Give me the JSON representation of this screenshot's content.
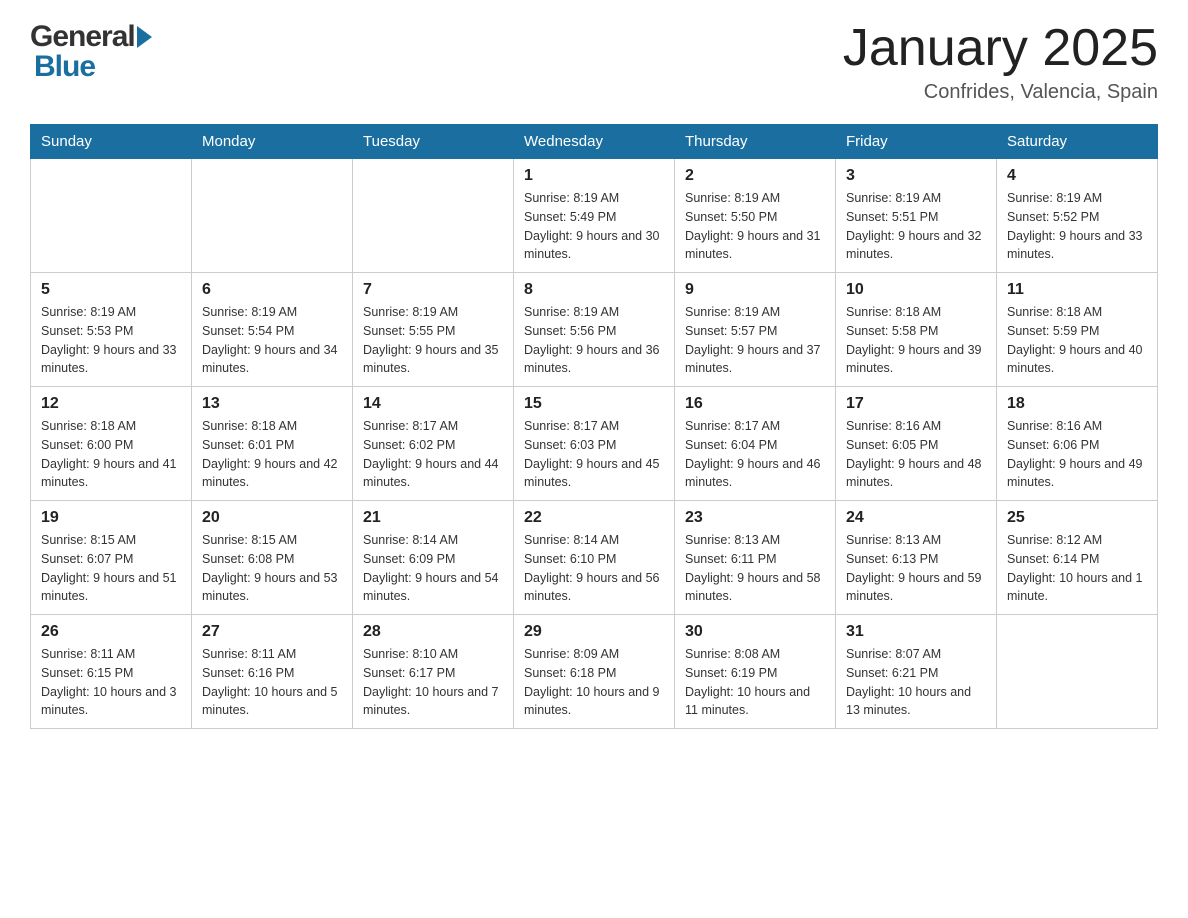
{
  "logo": {
    "text_general": "General",
    "triangle": "▶",
    "text_blue": "Blue"
  },
  "header": {
    "month_title": "January 2025",
    "location": "Confrides, Valencia, Spain"
  },
  "days_of_week": [
    "Sunday",
    "Monday",
    "Tuesday",
    "Wednesday",
    "Thursday",
    "Friday",
    "Saturday"
  ],
  "weeks": [
    [
      {
        "day": "",
        "info": ""
      },
      {
        "day": "",
        "info": ""
      },
      {
        "day": "",
        "info": ""
      },
      {
        "day": "1",
        "info": "Sunrise: 8:19 AM\nSunset: 5:49 PM\nDaylight: 9 hours and 30 minutes."
      },
      {
        "day": "2",
        "info": "Sunrise: 8:19 AM\nSunset: 5:50 PM\nDaylight: 9 hours and 31 minutes."
      },
      {
        "day": "3",
        "info": "Sunrise: 8:19 AM\nSunset: 5:51 PM\nDaylight: 9 hours and 32 minutes."
      },
      {
        "day": "4",
        "info": "Sunrise: 8:19 AM\nSunset: 5:52 PM\nDaylight: 9 hours and 33 minutes."
      }
    ],
    [
      {
        "day": "5",
        "info": "Sunrise: 8:19 AM\nSunset: 5:53 PM\nDaylight: 9 hours and 33 minutes."
      },
      {
        "day": "6",
        "info": "Sunrise: 8:19 AM\nSunset: 5:54 PM\nDaylight: 9 hours and 34 minutes."
      },
      {
        "day": "7",
        "info": "Sunrise: 8:19 AM\nSunset: 5:55 PM\nDaylight: 9 hours and 35 minutes."
      },
      {
        "day": "8",
        "info": "Sunrise: 8:19 AM\nSunset: 5:56 PM\nDaylight: 9 hours and 36 minutes."
      },
      {
        "day": "9",
        "info": "Sunrise: 8:19 AM\nSunset: 5:57 PM\nDaylight: 9 hours and 37 minutes."
      },
      {
        "day": "10",
        "info": "Sunrise: 8:18 AM\nSunset: 5:58 PM\nDaylight: 9 hours and 39 minutes."
      },
      {
        "day": "11",
        "info": "Sunrise: 8:18 AM\nSunset: 5:59 PM\nDaylight: 9 hours and 40 minutes."
      }
    ],
    [
      {
        "day": "12",
        "info": "Sunrise: 8:18 AM\nSunset: 6:00 PM\nDaylight: 9 hours and 41 minutes."
      },
      {
        "day": "13",
        "info": "Sunrise: 8:18 AM\nSunset: 6:01 PM\nDaylight: 9 hours and 42 minutes."
      },
      {
        "day": "14",
        "info": "Sunrise: 8:17 AM\nSunset: 6:02 PM\nDaylight: 9 hours and 44 minutes."
      },
      {
        "day": "15",
        "info": "Sunrise: 8:17 AM\nSunset: 6:03 PM\nDaylight: 9 hours and 45 minutes."
      },
      {
        "day": "16",
        "info": "Sunrise: 8:17 AM\nSunset: 6:04 PM\nDaylight: 9 hours and 46 minutes."
      },
      {
        "day": "17",
        "info": "Sunrise: 8:16 AM\nSunset: 6:05 PM\nDaylight: 9 hours and 48 minutes."
      },
      {
        "day": "18",
        "info": "Sunrise: 8:16 AM\nSunset: 6:06 PM\nDaylight: 9 hours and 49 minutes."
      }
    ],
    [
      {
        "day": "19",
        "info": "Sunrise: 8:15 AM\nSunset: 6:07 PM\nDaylight: 9 hours and 51 minutes."
      },
      {
        "day": "20",
        "info": "Sunrise: 8:15 AM\nSunset: 6:08 PM\nDaylight: 9 hours and 53 minutes."
      },
      {
        "day": "21",
        "info": "Sunrise: 8:14 AM\nSunset: 6:09 PM\nDaylight: 9 hours and 54 minutes."
      },
      {
        "day": "22",
        "info": "Sunrise: 8:14 AM\nSunset: 6:10 PM\nDaylight: 9 hours and 56 minutes."
      },
      {
        "day": "23",
        "info": "Sunrise: 8:13 AM\nSunset: 6:11 PM\nDaylight: 9 hours and 58 minutes."
      },
      {
        "day": "24",
        "info": "Sunrise: 8:13 AM\nSunset: 6:13 PM\nDaylight: 9 hours and 59 minutes."
      },
      {
        "day": "25",
        "info": "Sunrise: 8:12 AM\nSunset: 6:14 PM\nDaylight: 10 hours and 1 minute."
      }
    ],
    [
      {
        "day": "26",
        "info": "Sunrise: 8:11 AM\nSunset: 6:15 PM\nDaylight: 10 hours and 3 minutes."
      },
      {
        "day": "27",
        "info": "Sunrise: 8:11 AM\nSunset: 6:16 PM\nDaylight: 10 hours and 5 minutes."
      },
      {
        "day": "28",
        "info": "Sunrise: 8:10 AM\nSunset: 6:17 PM\nDaylight: 10 hours and 7 minutes."
      },
      {
        "day": "29",
        "info": "Sunrise: 8:09 AM\nSunset: 6:18 PM\nDaylight: 10 hours and 9 minutes."
      },
      {
        "day": "30",
        "info": "Sunrise: 8:08 AM\nSunset: 6:19 PM\nDaylight: 10 hours and 11 minutes."
      },
      {
        "day": "31",
        "info": "Sunrise: 8:07 AM\nSunset: 6:21 PM\nDaylight: 10 hours and 13 minutes."
      },
      {
        "day": "",
        "info": ""
      }
    ]
  ]
}
